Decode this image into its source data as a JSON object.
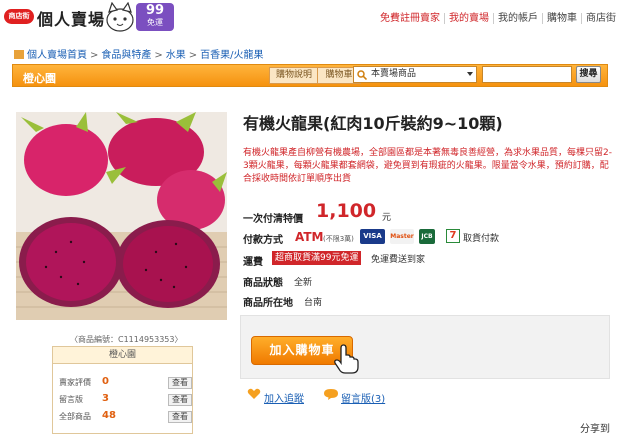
{
  "header": {
    "logo_badge": "商店街",
    "logo_text": "個人賣場",
    "promo_number": "99",
    "promo_text": "免運",
    "links": [
      "免費註冊賣家",
      "我的賣場",
      "我的帳戶",
      "購物車",
      "商店街"
    ]
  },
  "breadcrumb": [
    "個人賣場首頁",
    "食品與特產",
    "水果",
    "百香果/火龍果"
  ],
  "storebar": {
    "store_name": "橙心園",
    "tabs": [
      "購物說明",
      "購物車"
    ],
    "search_scope": "本賣場商品",
    "search_placeholder": "",
    "search_button": "搜尋"
  },
  "product": {
    "title": "有機火龍果(紅肉10斤裝約9~10顆)",
    "description": "有機火龍果產自柳營有機農場，全部園區都是本著無毒良善經營，為求水果品質，每棵只留2-3顆火龍果，每顆火龍果都套網袋，避免買到有瑕疵的火龍果。限量當令水果，預約訂購，配合採收時間依訂單順序出貨",
    "code": "〈商品編號：C1114953353〉",
    "price_label": "一次付清特價",
    "price": "1,100",
    "price_unit": "元",
    "payment_label": "付款方式",
    "atm": "ATM",
    "atm_note": "(不限3萬)",
    "cards": [
      "VISA",
      "Master",
      "JCB",
      "7"
    ],
    "cod": "取貨付款",
    "shipping_label": "運費",
    "shipping_badge": "超商取貨滿99元免運",
    "shipping_text": "免運費送到家",
    "condition_label": "商品狀態",
    "condition": "全新",
    "location_label": "商品所在地",
    "location": "台南"
  },
  "shop": {
    "name": "橙心園",
    "rows": [
      {
        "label": "賣家評價",
        "value": "0",
        "action": "查看"
      },
      {
        "label": "留言版",
        "value": "3",
        "action": "查看"
      },
      {
        "label": "全部商品",
        "value": "48",
        "action": "查看"
      }
    ]
  },
  "cart": {
    "add_button": "加入購物車",
    "track_link": "加入追蹤",
    "message_link": "留言版(3)",
    "share": "分享到"
  },
  "colors": {
    "accent": "#f5920f",
    "price": "#d0262a",
    "link": "#1a5fb4"
  }
}
